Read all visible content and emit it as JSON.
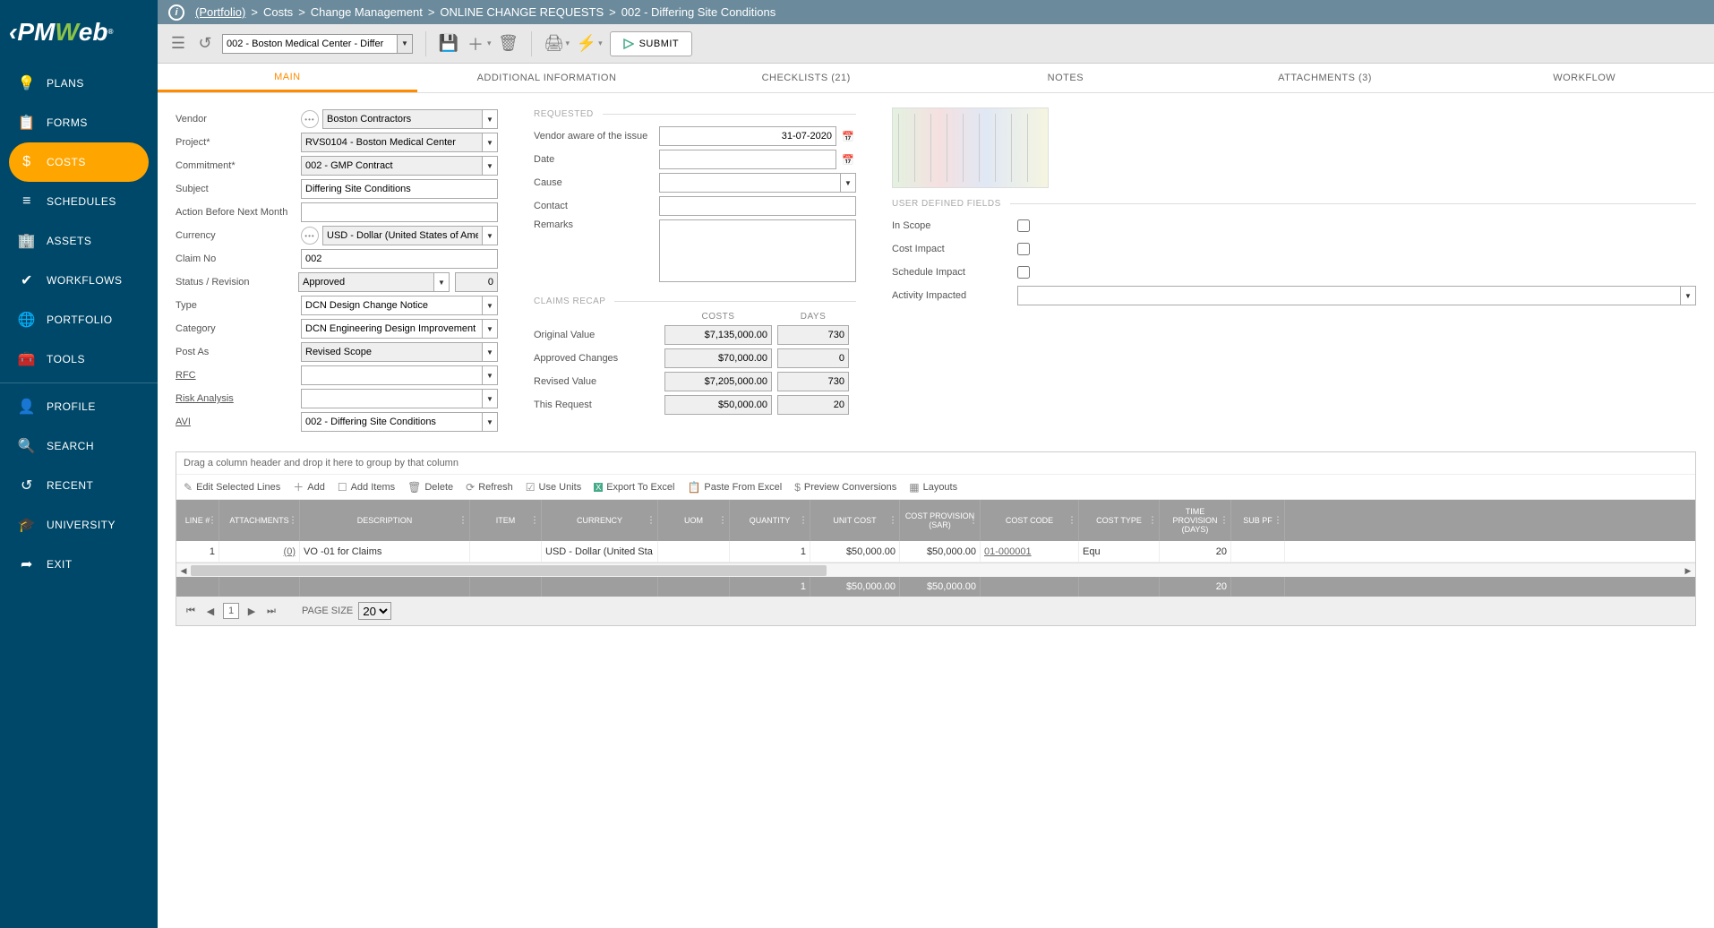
{
  "sidebar": {
    "items": [
      {
        "label": "PLANS",
        "icon": "💡"
      },
      {
        "label": "FORMS",
        "icon": "📋"
      },
      {
        "label": "COSTS",
        "icon": "$",
        "active": true
      },
      {
        "label": "SCHEDULES",
        "icon": "≡"
      },
      {
        "label": "ASSETS",
        "icon": "🏢"
      },
      {
        "label": "WORKFLOWS",
        "icon": "✔"
      },
      {
        "label": "PORTFOLIO",
        "icon": "🌐"
      },
      {
        "label": "TOOLS",
        "icon": "🧰"
      }
    ],
    "items2": [
      {
        "label": "PROFILE",
        "icon": "👤"
      },
      {
        "label": "SEARCH",
        "icon": "🔍"
      },
      {
        "label": "RECENT",
        "icon": "↺"
      },
      {
        "label": "UNIVERSITY",
        "icon": "🎓"
      },
      {
        "label": "EXIT",
        "icon": "➦"
      }
    ]
  },
  "breadcrumb": {
    "portfolio": "(Portfolio)",
    "p1": "Costs",
    "p2": "Change Management",
    "p3": "ONLINE CHANGE REQUESTS",
    "p4": "002 - Differing Site Conditions"
  },
  "toolbar": {
    "record_select": "002 - Boston Medical Center - Differ",
    "submit": "SUBMIT"
  },
  "tabs": [
    "MAIN",
    "ADDITIONAL INFORMATION",
    "CHECKLISTS (21)",
    "NOTES",
    "ATTACHMENTS (3)",
    "WORKFLOW"
  ],
  "form": {
    "labels": {
      "vendor": "Vendor",
      "project": "Project*",
      "commitment": "Commitment*",
      "subject": "Subject",
      "abnm": "Action Before Next Month",
      "currency": "Currency",
      "claim": "Claim No",
      "status": "Status / Revision",
      "type": "Type",
      "category": "Category",
      "postas": "Post As",
      "rfc": "RFC",
      "risk": "Risk Analysis",
      "avi": "AVI"
    },
    "values": {
      "vendor": "Boston Contractors",
      "project": "RVS0104 - Boston Medical Center",
      "commitment": "002 - GMP Contract",
      "subject": "Differing Site Conditions",
      "abnm": "",
      "currency": "USD - Dollar (United States of America)",
      "claim": "002",
      "status": "Approved",
      "revision": "0",
      "type": "DCN Design Change Notice",
      "category": "DCN Engineering Design Improvement",
      "postas": "Revised Scope",
      "rfc": "",
      "risk": "",
      "avi": "002 - Differing Site Conditions"
    },
    "req": {
      "hdr": "REQUESTED",
      "labels": {
        "aware": "Vendor aware of the issue",
        "date": "Date",
        "cause": "Cause",
        "contact": "Contact",
        "remarks": "Remarks"
      },
      "values": {
        "aware": "31-07-2020",
        "date": "",
        "cause": "",
        "contact": "",
        "remarks": ""
      }
    },
    "recap": {
      "hdr": "CLAIMS RECAP",
      "cols": {
        "costs": "COSTS",
        "days": "DAYS"
      },
      "rows": [
        {
          "lbl": "Original Value",
          "c": "$7,135,000.00",
          "d": "730"
        },
        {
          "lbl": "Approved Changes",
          "c": "$70,000.00",
          "d": "0"
        },
        {
          "lbl": "Revised Value",
          "c": "$7,205,000.00",
          "d": "730"
        },
        {
          "lbl": "This Request",
          "c": "$50,000.00",
          "d": "20"
        }
      ]
    },
    "udf": {
      "hdr": "USER DEFINED FIELDS",
      "inscope": "In Scope",
      "costimpact": "Cost Impact",
      "schedimpact": "Schedule Impact",
      "activity": "Activity Impacted"
    }
  },
  "grid": {
    "group_text": "Drag a column header and drop it here to group by that column",
    "toolbar": {
      "edit": "Edit Selected Lines",
      "add": "Add",
      "additems": "Add Items",
      "delete": "Delete",
      "refresh": "Refresh",
      "useunits": "Use Units",
      "expexcel": "Export To Excel",
      "pasteexcel": "Paste From Excel",
      "preview": "Preview Conversions",
      "layouts": "Layouts"
    },
    "cols": [
      "LINE #",
      "ATTACHMENTS",
      "DESCRIPTION",
      "ITEM",
      "CURRENCY",
      "UOM",
      "QUANTITY",
      "UNIT COST",
      "COST PROVISION (SAR)",
      "COST CODE",
      "COST TYPE",
      "TIME PROVISION (DAYS)",
      "SUB PF"
    ],
    "row": {
      "line": "1",
      "att": "(0)",
      "desc": "VO -01 for Claims",
      "item": "",
      "currency": "USD - Dollar (United Sta",
      "uom": "",
      "qty": "1",
      "unitcost": "$50,000.00",
      "costprov": "$50,000.00",
      "code": "01-000001",
      "type": "Equ",
      "days": "20"
    },
    "footer": {
      "qty": "1",
      "unitcost": "$50,000.00",
      "costprov": "$50,000.00",
      "days": "20"
    },
    "pager": {
      "page": "1",
      "sizelbl": "PAGE SIZE",
      "size": "20"
    }
  }
}
